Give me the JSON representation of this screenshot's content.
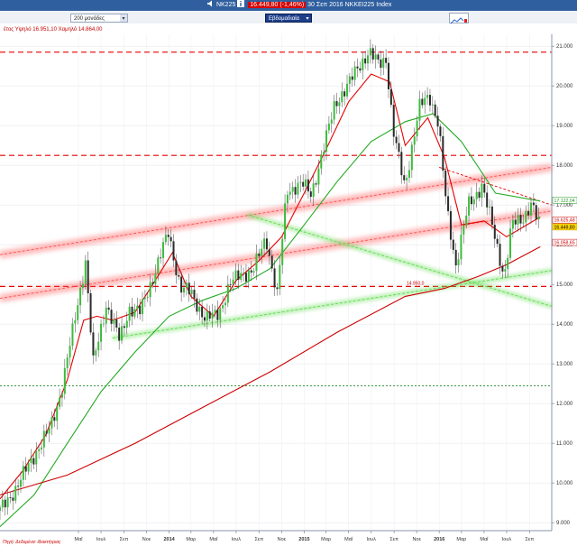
{
  "header": {
    "ticker": "NK225",
    "price_text": "16.449,80 (-1,46%)",
    "date_text": "30 Σεπ 2016 NKKEI225 Index"
  },
  "toolbar": {
    "period_select": "200 μονάδες",
    "interval_select": "Εβδομαδιαία"
  },
  "range_text": "έτος Υψηλό 16.951,10 Χαμηλό 14.864,00",
  "chart_data": {
    "type": "candlestick",
    "title": "",
    "xlabel": "",
    "ylabel": "",
    "ylim": [
      8800,
      21300
    ],
    "y_ticks": [
      9000,
      10000,
      11000,
      12000,
      13000,
      14000,
      15000,
      16000,
      17000,
      18000,
      19000,
      20000,
      21000
    ],
    "y_tick_labels": [
      "9.000",
      "10.000",
      "11.000",
      "12.000",
      "13.000",
      "14.000",
      "15.000",
      "16.000",
      "17.000",
      "18.000",
      "19.000",
      "20.000",
      "21.000"
    ],
    "x_range": [
      "2012-10-01",
      "2016-10-31"
    ],
    "x_ticks": [
      {
        "date": "2013-05-01",
        "label": "Μαΐ"
      },
      {
        "date": "2013-07-01",
        "label": "Ιουλ"
      },
      {
        "date": "2013-09-01",
        "label": "Σεπ"
      },
      {
        "date": "2013-11-01",
        "label": "Νοε"
      },
      {
        "date": "2014-01-01",
        "label": "2014"
      },
      {
        "date": "2014-03-01",
        "label": "Μαρ"
      },
      {
        "date": "2014-05-01",
        "label": "Μαΐ"
      },
      {
        "date": "2014-07-01",
        "label": "Ιουλ"
      },
      {
        "date": "2014-09-01",
        "label": "Σεπ"
      },
      {
        "date": "2014-11-01",
        "label": "Νοε"
      },
      {
        "date": "2015-01-01",
        "label": "2015"
      },
      {
        "date": "2015-03-01",
        "label": "Μαρ"
      },
      {
        "date": "2015-05-01",
        "label": "Μαΐ"
      },
      {
        "date": "2015-07-01",
        "label": "Ιουλ"
      },
      {
        "date": "2015-09-01",
        "label": "Σεπ"
      },
      {
        "date": "2015-11-01",
        "label": "Νοε"
      },
      {
        "date": "2016-01-01",
        "label": "2016"
      },
      {
        "date": "2016-03-01",
        "label": "Μαρ"
      },
      {
        "date": "2016-05-01",
        "label": "Μαΐ"
      },
      {
        "date": "2016-07-01",
        "label": "Ιουλ"
      },
      {
        "date": "2016-09-01",
        "label": "Σεπ"
      }
    ],
    "price_path": [
      [
        "2012-10-01",
        9300
      ],
      [
        "2012-11-15",
        9900
      ],
      [
        "2013-01-01",
        10700
      ],
      [
        "2013-02-15",
        11400
      ],
      [
        "2013-03-15",
        12300
      ],
      [
        "2013-04-15",
        13800
      ],
      [
        "2013-05-20",
        15600
      ],
      [
        "2013-06-10",
        13000
      ],
      [
        "2013-07-15",
        14500
      ],
      [
        "2013-08-20",
        13600
      ],
      [
        "2013-09-15",
        14400
      ],
      [
        "2013-10-15",
        14300
      ],
      [
        "2013-11-15",
        15100
      ],
      [
        "2013-12-30",
        16300
      ],
      [
        "2014-02-01",
        14900
      ],
      [
        "2014-03-01",
        14800
      ],
      [
        "2014-04-10",
        14100
      ],
      [
        "2014-05-15",
        14300
      ],
      [
        "2014-06-15",
        15000
      ],
      [
        "2014-07-15",
        15300
      ],
      [
        "2014-08-15",
        15300
      ],
      [
        "2014-09-20",
        16200
      ],
      [
        "2014-10-20",
        14700
      ],
      [
        "2014-11-15",
        17400
      ],
      [
        "2014-12-30",
        17500
      ],
      [
        "2015-01-20",
        17300
      ],
      [
        "2015-02-20",
        18300
      ],
      [
        "2015-03-25",
        19600
      ],
      [
        "2015-04-25",
        19900
      ],
      [
        "2015-05-25",
        20500
      ],
      [
        "2015-06-25",
        20800
      ],
      [
        "2015-07-20",
        20600
      ],
      [
        "2015-08-10",
        20700
      ],
      [
        "2015-08-30",
        18800
      ],
      [
        "2015-09-30",
        17500
      ],
      [
        "2015-11-10",
        19500
      ],
      [
        "2015-12-05",
        19800
      ],
      [
        "2015-12-30",
        19000
      ],
      [
        "2016-01-20",
        17000
      ],
      [
        "2016-02-15",
        15500
      ],
      [
        "2016-03-20",
        17000
      ],
      [
        "2016-04-25",
        17500
      ],
      [
        "2016-05-20",
        16600
      ],
      [
        "2016-06-25",
        15200
      ],
      [
        "2016-07-15",
        16500
      ],
      [
        "2016-08-15",
        16700
      ],
      [
        "2016-09-05",
        17000
      ],
      [
        "2016-09-30",
        16450
      ]
    ],
    "moving_averages": [
      {
        "color": "#e60000",
        "points": [
          [
            "2012-10-01",
            9600
          ],
          [
            "2012-12-01",
            10300
          ],
          [
            "2013-02-01",
            11200
          ],
          [
            "2013-04-01",
            12600
          ],
          [
            "2013-05-15",
            14100
          ],
          [
            "2013-06-20",
            14200
          ],
          [
            "2013-08-01",
            14100
          ],
          [
            "2013-10-01",
            14300
          ],
          [
            "2013-12-01",
            15200
          ],
          [
            "2014-01-10",
            15800
          ],
          [
            "2014-03-01",
            14700
          ],
          [
            "2014-05-01",
            14200
          ],
          [
            "2014-07-01",
            15100
          ],
          [
            "2014-09-01",
            15600
          ],
          [
            "2014-11-01",
            16200
          ],
          [
            "2015-01-01",
            17300
          ],
          [
            "2015-03-01",
            18400
          ],
          [
            "2015-05-01",
            19600
          ],
          [
            "2015-07-01",
            20300
          ],
          [
            "2015-08-20",
            20100
          ],
          [
            "2015-10-01",
            18500
          ],
          [
            "2015-12-01",
            19200
          ],
          [
            "2016-01-15",
            18200
          ],
          [
            "2016-03-01",
            16500
          ],
          [
            "2016-05-01",
            16600
          ],
          [
            "2016-07-01",
            16200
          ],
          [
            "2016-09-30",
            16700
          ]
        ]
      },
      {
        "color": "#22aa22",
        "points": [
          [
            "2012-10-01",
            8900
          ],
          [
            "2013-01-01",
            9700
          ],
          [
            "2013-04-01",
            11000
          ],
          [
            "2013-07-01",
            12300
          ],
          [
            "2013-10-01",
            13300
          ],
          [
            "2014-01-01",
            14200
          ],
          [
            "2014-04-01",
            14600
          ],
          [
            "2014-07-01",
            14900
          ],
          [
            "2014-10-01",
            15400
          ],
          [
            "2015-01-01",
            16500
          ],
          [
            "2015-04-01",
            17600
          ],
          [
            "2015-07-01",
            18600
          ],
          [
            "2015-10-01",
            19100
          ],
          [
            "2015-12-15",
            19300
          ],
          [
            "2016-03-01",
            18600
          ],
          [
            "2016-06-01",
            17300
          ],
          [
            "2016-09-30",
            17100
          ]
        ]
      },
      {
        "color": "#cc0000",
        "points": [
          [
            "2012-10-01",
            9700
          ],
          [
            "2013-04-01",
            10200
          ],
          [
            "2013-10-01",
            11000
          ],
          [
            "2014-04-01",
            11900
          ],
          [
            "2014-10-01",
            12800
          ],
          [
            "2015-04-01",
            13800
          ],
          [
            "2015-10-01",
            14700
          ],
          [
            "2016-01-15",
            14900
          ],
          [
            "2016-04-15",
            15200
          ],
          [
            "2016-07-01",
            15500
          ],
          [
            "2016-09-30",
            15950
          ]
        ]
      }
    ],
    "horizontal_lines": [
      {
        "value": 20850,
        "color": "#e60000",
        "style": "dashed"
      },
      {
        "value": 18250,
        "color": "#e60000",
        "style": "dashed"
      },
      {
        "value": 14950,
        "color": "#e60000",
        "style": "dashed"
      },
      {
        "value": 12450,
        "color": "#007700",
        "style": "dotted"
      }
    ],
    "trend_lines": [
      {
        "from": [
          "2012-10-01",
          15750
        ],
        "to": [
          "2016-10-31",
          17950
        ],
        "color": "#ff5a5a",
        "glow": true
      },
      {
        "from": [
          "2012-10-01",
          14650
        ],
        "to": [
          "2016-10-31",
          16850
        ],
        "color": "#ff5a5a",
        "glow": true
      },
      {
        "from": [
          "2013-08-01",
          13650
        ],
        "to": [
          "2016-10-31",
          15350
        ],
        "color": "#66dd55",
        "glow": true
      },
      {
        "from": [
          "2014-08-01",
          16750
        ],
        "to": [
          "2016-10-31",
          14450
        ],
        "color": "#66dd55",
        "glow": true
      },
      {
        "from": [
          "2016-01-01",
          17950
        ],
        "to": [
          "2016-10-31",
          17000
        ],
        "color": "#e60000",
        "glow": false
      }
    ],
    "price_tags": [
      {
        "value": 17122.04,
        "label": "17.122,04",
        "bg": "#ffffff",
        "fg": "#229922",
        "border": "#229922"
      },
      {
        "value": 16625.48,
        "label": "16.625,48",
        "bg": "#ffffff",
        "fg": "#cc0000",
        "border": "#cc0000"
      },
      {
        "value": 16449.8,
        "label": "16.449,80",
        "bg": "#ffd700",
        "fg": "#000000",
        "border": "#c9a400"
      },
      {
        "value": 16058.65,
        "label": "16.058,65",
        "bg": "#ffffff",
        "fg": "#cc0000",
        "border": "#cc0000"
      }
    ],
    "annotation": {
      "date": "2016-01-15",
      "value": 14950,
      "label": "14.950,0"
    },
    "footnote": "Πηγή: Δεδομένα: iδιοκτήτριας"
  }
}
